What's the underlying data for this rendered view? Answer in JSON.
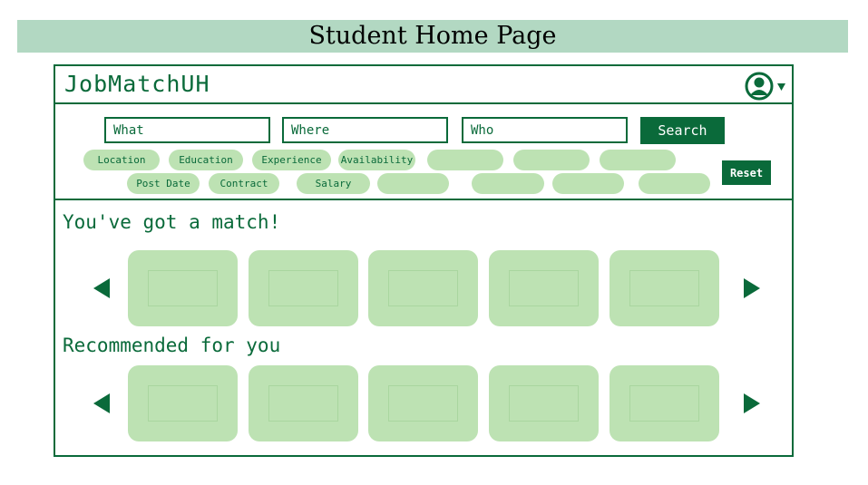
{
  "slide": {
    "title": "Student Home Page"
  },
  "header": {
    "logo": "JobMatchUH",
    "user_icon": "user-circle-icon",
    "dropdown_icon": "caret-down-icon"
  },
  "search": {
    "what_placeholder": "What",
    "where_placeholder": "Where",
    "who_placeholder": "Who",
    "search_label": "Search",
    "reset_label": "Reset"
  },
  "filters": {
    "row1": [
      "Location",
      "Education",
      "Experience",
      "Availability",
      "",
      "",
      ""
    ],
    "row2": [
      "Post Date",
      "Contract",
      "Salary",
      "",
      "",
      "",
      ""
    ]
  },
  "match": {
    "heading": "You've got a match!"
  },
  "recommended": {
    "heading": "Recommended for you"
  },
  "colors": {
    "primary": "#0a6a3a",
    "light": "#bde2b3",
    "title_bar": "#b2d8c2"
  }
}
